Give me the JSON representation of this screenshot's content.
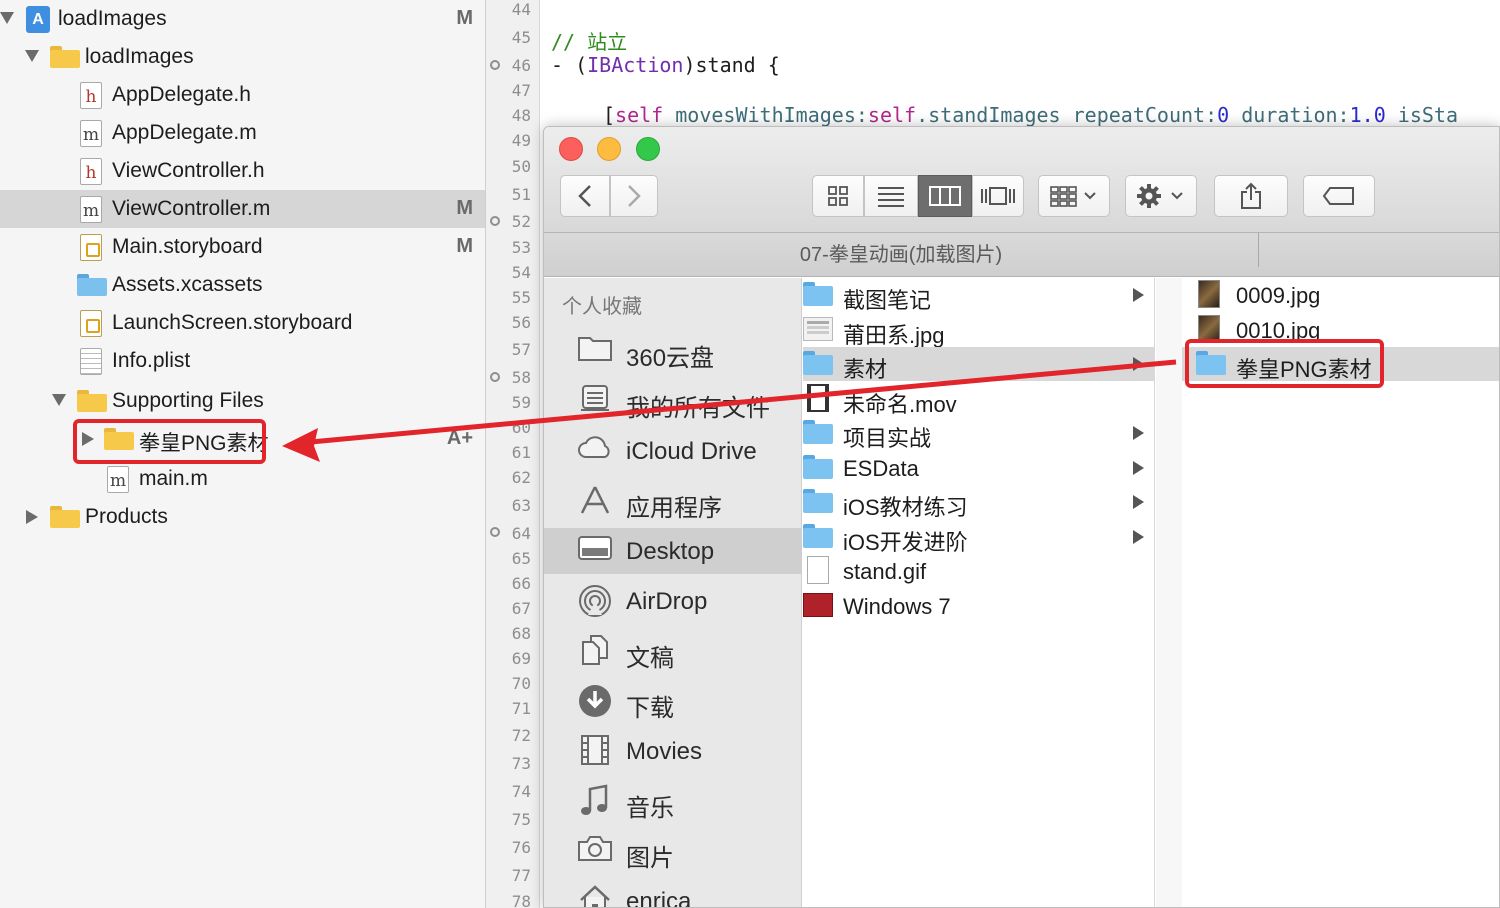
{
  "navigator": {
    "items": [
      {
        "label": "loadImages",
        "badge": "M"
      },
      {
        "label": "loadImages",
        "badge": ""
      },
      {
        "label": "AppDelegate.h",
        "badge": "",
        "icon_letter": "h"
      },
      {
        "label": "AppDelegate.m",
        "badge": "",
        "icon_letter": "m"
      },
      {
        "label": "ViewController.h",
        "badge": "",
        "icon_letter": "h"
      },
      {
        "label": "ViewController.m",
        "badge": "M",
        "icon_letter": "m"
      },
      {
        "label": "Main.storyboard",
        "badge": "M"
      },
      {
        "label": "Assets.xcassets",
        "badge": ""
      },
      {
        "label": "LaunchScreen.storyboard",
        "badge": ""
      },
      {
        "label": "Info.plist",
        "badge": ""
      },
      {
        "label": "Supporting Files",
        "badge": ""
      },
      {
        "label": "拳皇PNG素材",
        "badge": "A+"
      },
      {
        "label": "main.m",
        "badge": "",
        "icon_letter": "m"
      },
      {
        "label": "Products",
        "badge": ""
      }
    ]
  },
  "gutter": {
    "line_numbers": [
      "44",
      "45",
      "46",
      "47",
      "48",
      "49",
      "50",
      "51",
      "52",
      "53",
      "54",
      "55",
      "56",
      "57",
      "58",
      "59",
      "60",
      "61",
      "62",
      "63",
      "64",
      "65",
      "66",
      "67",
      "68",
      "69",
      "70",
      "71",
      "72",
      "73",
      "74",
      "75",
      "76",
      "77",
      "78"
    ]
  },
  "code": {
    "comment": "// 站立",
    "method_prefix": "- (",
    "method_type": "IBAction",
    "method_name": ")stand {",
    "call_open": "[",
    "self1": "self",
    "call_sel1": " movesWithImages:",
    "self2": "self",
    "call_prop": ".standImages",
    "call_sel2": " repeatCount:",
    "num1": "0",
    "call_sel3": " duration:",
    "num2": "1.0",
    "call_sel4": " isSta"
  },
  "finder": {
    "path_title": "07-拳皇动画(加载图片)",
    "sidebar_header": "个人收藏",
    "sidebar_items": [
      {
        "label": "360云盘",
        "icon": "folder-icon"
      },
      {
        "label": "我的所有文件",
        "icon": "all-files-icon"
      },
      {
        "label": "iCloud Drive",
        "icon": "cloud-icon"
      },
      {
        "label": "应用程序",
        "icon": "applications-icon"
      },
      {
        "label": "Desktop",
        "icon": "desktop-icon"
      },
      {
        "label": "AirDrop",
        "icon": "airdrop-icon"
      },
      {
        "label": "文稿",
        "icon": "documents-icon"
      },
      {
        "label": "下载",
        "icon": "download-icon"
      },
      {
        "label": "Movies",
        "icon": "movies-icon"
      },
      {
        "label": "音乐",
        "icon": "music-icon"
      },
      {
        "label": "图片",
        "icon": "camera-icon"
      },
      {
        "label": "enrica",
        "icon": "home-icon"
      }
    ],
    "column1": [
      {
        "name": "截图笔记",
        "kind": "folder",
        "arrow": true
      },
      {
        "name": "莆田系.jpg",
        "kind": "image",
        "arrow": false
      },
      {
        "name": "素材",
        "kind": "folder",
        "arrow": true
      },
      {
        "name": "未命名.mov",
        "kind": "movie",
        "arrow": false
      },
      {
        "name": "项目实战",
        "kind": "folder",
        "arrow": true
      },
      {
        "name": "ESData",
        "kind": "folder",
        "arrow": true
      },
      {
        "name": "iOS教材练习",
        "kind": "folder",
        "arrow": true
      },
      {
        "name": "iOS开发进阶",
        "kind": "folder",
        "arrow": true
      },
      {
        "name": "stand.gif",
        "kind": "gif",
        "arrow": false
      },
      {
        "name": "Windows 7",
        "kind": "windows",
        "arrow": false
      }
    ],
    "column2": [
      {
        "name": "0009.jpg",
        "kind": "thumb"
      },
      {
        "name": "0010.jpg",
        "kind": "thumb"
      },
      {
        "name": "拳皇PNG素材",
        "kind": "folder"
      }
    ]
  },
  "colors": {
    "annotation_red": "#e2242b",
    "traffic_close": "#fc605c",
    "traffic_min": "#fdbc40",
    "traffic_max": "#34c84a"
  }
}
